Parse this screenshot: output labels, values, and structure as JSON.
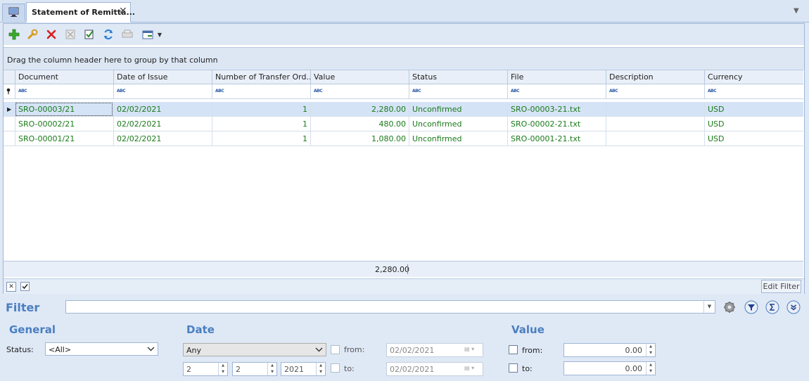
{
  "tab": {
    "title": "Statement of Remitta...",
    "close": "✕"
  },
  "group_hint": "Drag the column header here to group by that column",
  "columns": [
    "Document",
    "Date of Issue",
    "Number of Transfer Ord...",
    "Value",
    "Status",
    "File",
    "Description",
    "Currency"
  ],
  "rows": [
    {
      "document": "SRO-00003/21",
      "date": "02/02/2021",
      "transfers": "1",
      "value": "2,280.00",
      "status": "Unconfirmed",
      "file": "SRO-00003-21.txt",
      "description": "",
      "currency": "USD"
    },
    {
      "document": "SRO-00002/21",
      "date": "02/02/2021",
      "transfers": "1",
      "value": "480.00",
      "status": "Unconfirmed",
      "file": "SRO-00002-21.txt",
      "description": "",
      "currency": "USD"
    },
    {
      "document": "SRO-00001/21",
      "date": "02/02/2021",
      "transfers": "1",
      "value": "1,080.00",
      "status": "Unconfirmed",
      "file": "SRO-00001-21.txt",
      "description": "",
      "currency": "USD"
    }
  ],
  "summary": {
    "value_total": "2,280.00"
  },
  "filter_bar": {
    "edit_filter": "Edit Filter"
  },
  "filter": {
    "title": "Filter",
    "general": {
      "title": "General",
      "status_label": "Status:",
      "status_value": "<All>"
    },
    "date": {
      "title": "Date",
      "mode": "Any",
      "spin1": "2",
      "spin2": "2",
      "year": "2021",
      "from_label": "from:",
      "to_label": "to:",
      "from_value": "02/02/2021",
      "to_value": "02/02/2021"
    },
    "value": {
      "title": "Value",
      "from_label": "from:",
      "to_label": "to:",
      "from_value": "0.00",
      "to_value": "0.00"
    }
  },
  "colors": {
    "accent": "#4a7fc1",
    "row_text": "#1a7a1a",
    "selected_row": "#d5e3f6"
  }
}
